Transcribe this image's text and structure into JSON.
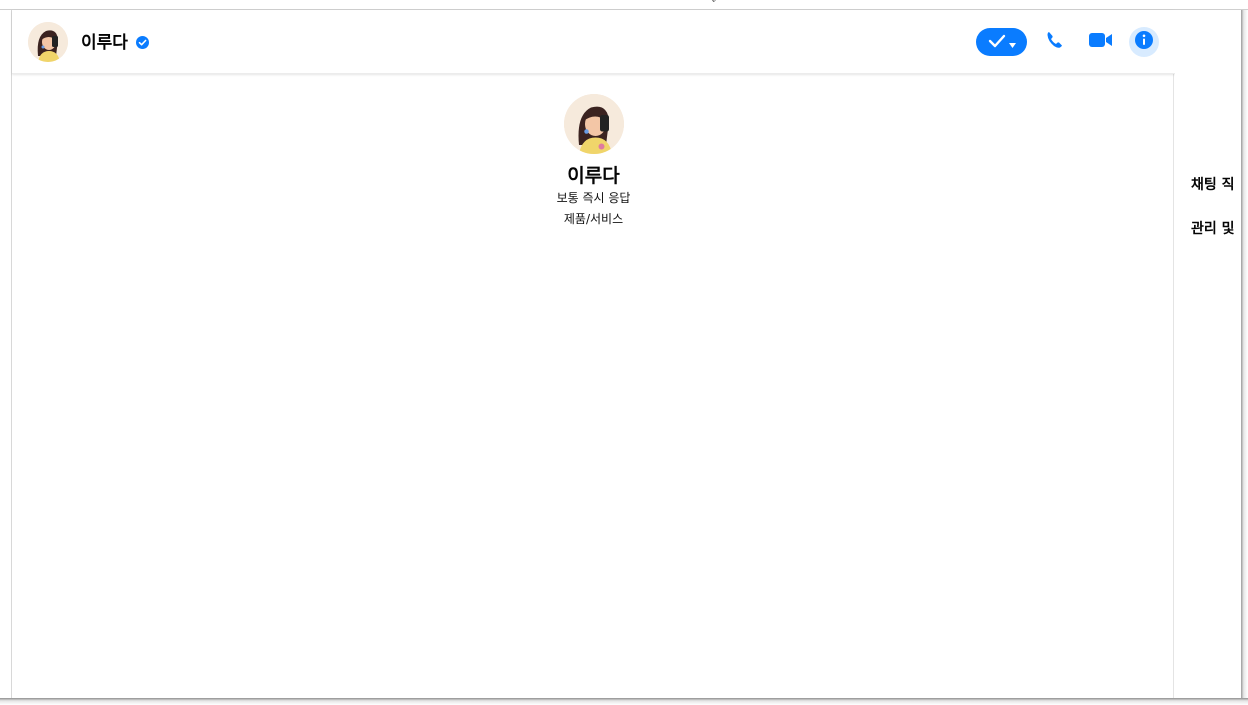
{
  "header": {
    "contact_name": "이루다",
    "avatar_icon": "avatar-illustration",
    "verified_icon": "verified-badge-icon",
    "actions": {
      "status_icon": "check-icon",
      "status_dropdown_icon": "caret-down-icon",
      "call_icon": "phone-icon",
      "video_icon": "video-camera-icon",
      "info_icon": "info-icon"
    }
  },
  "profile": {
    "name": "이루다",
    "response_time": "보통 즉시 응답",
    "category": "제품/서비스"
  },
  "right_panel": {
    "items": [
      "채팅 직",
      "관리 및"
    ]
  },
  "colors": {
    "accent": "#0a7cff",
    "info_bg": "#d8ebff",
    "text": "#050505"
  }
}
